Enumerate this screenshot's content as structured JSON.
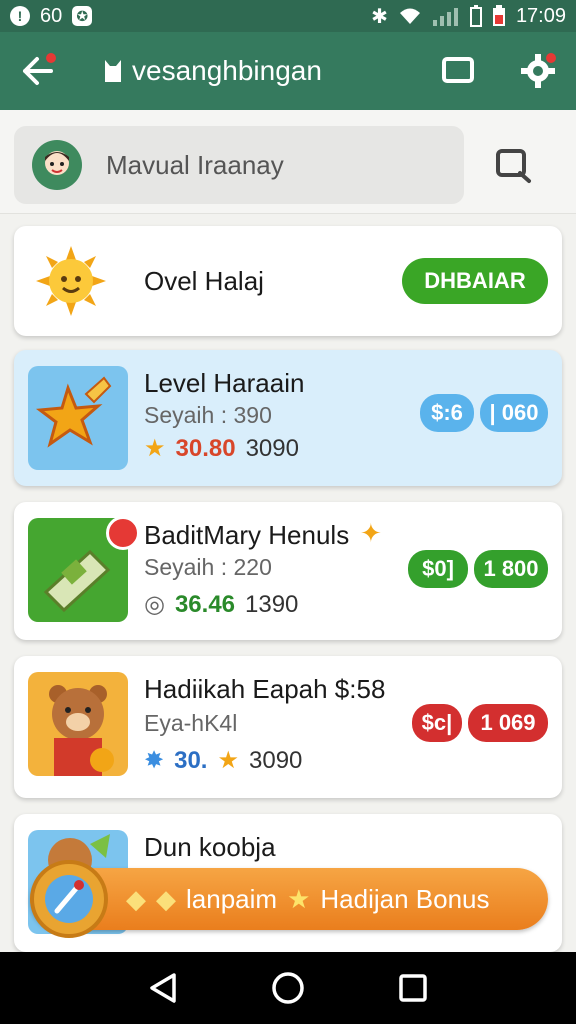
{
  "status_bar": {
    "left_number": "60",
    "time": "17:09"
  },
  "app_bar": {
    "title": "vesanghbingan",
    "back_icon": "back-arrow-icon",
    "window_icon": "window-icon",
    "settings_icon": "gear-icon"
  },
  "search": {
    "name": "Mavual Iraanay"
  },
  "cards": [
    {
      "title": "Ovel Halaj",
      "button": "DHBAIAR",
      "button_color": "#3aa626"
    },
    {
      "title": "Level Haraain",
      "subtitle": "Seyaih : 390",
      "stat_a": "30.80",
      "stat_b": "3090",
      "pill_left": "$:6",
      "pill_right": "| 060",
      "pill_color": "#5ab3ec"
    },
    {
      "title": "BaditMary Henuls",
      "subtitle": "Seyaih : 220",
      "stat_a": "36.46",
      "stat_b": "1390",
      "pill_left": "$0]",
      "pill_right": "1 800",
      "pill_color": "#34a02c"
    },
    {
      "title": "Hadiikah Eapah $:58",
      "subtitle": "Eya-hK4l",
      "stat_a": "30.",
      "stat_b": "3090",
      "pill_left": "$c|",
      "pill_right": "1 069",
      "pill_color": "#d32f2f"
    },
    {
      "title": "Dun koobja"
    }
  ],
  "bonus": {
    "label_a": "lanpaim",
    "label_b": "Hadijan Bonus"
  }
}
